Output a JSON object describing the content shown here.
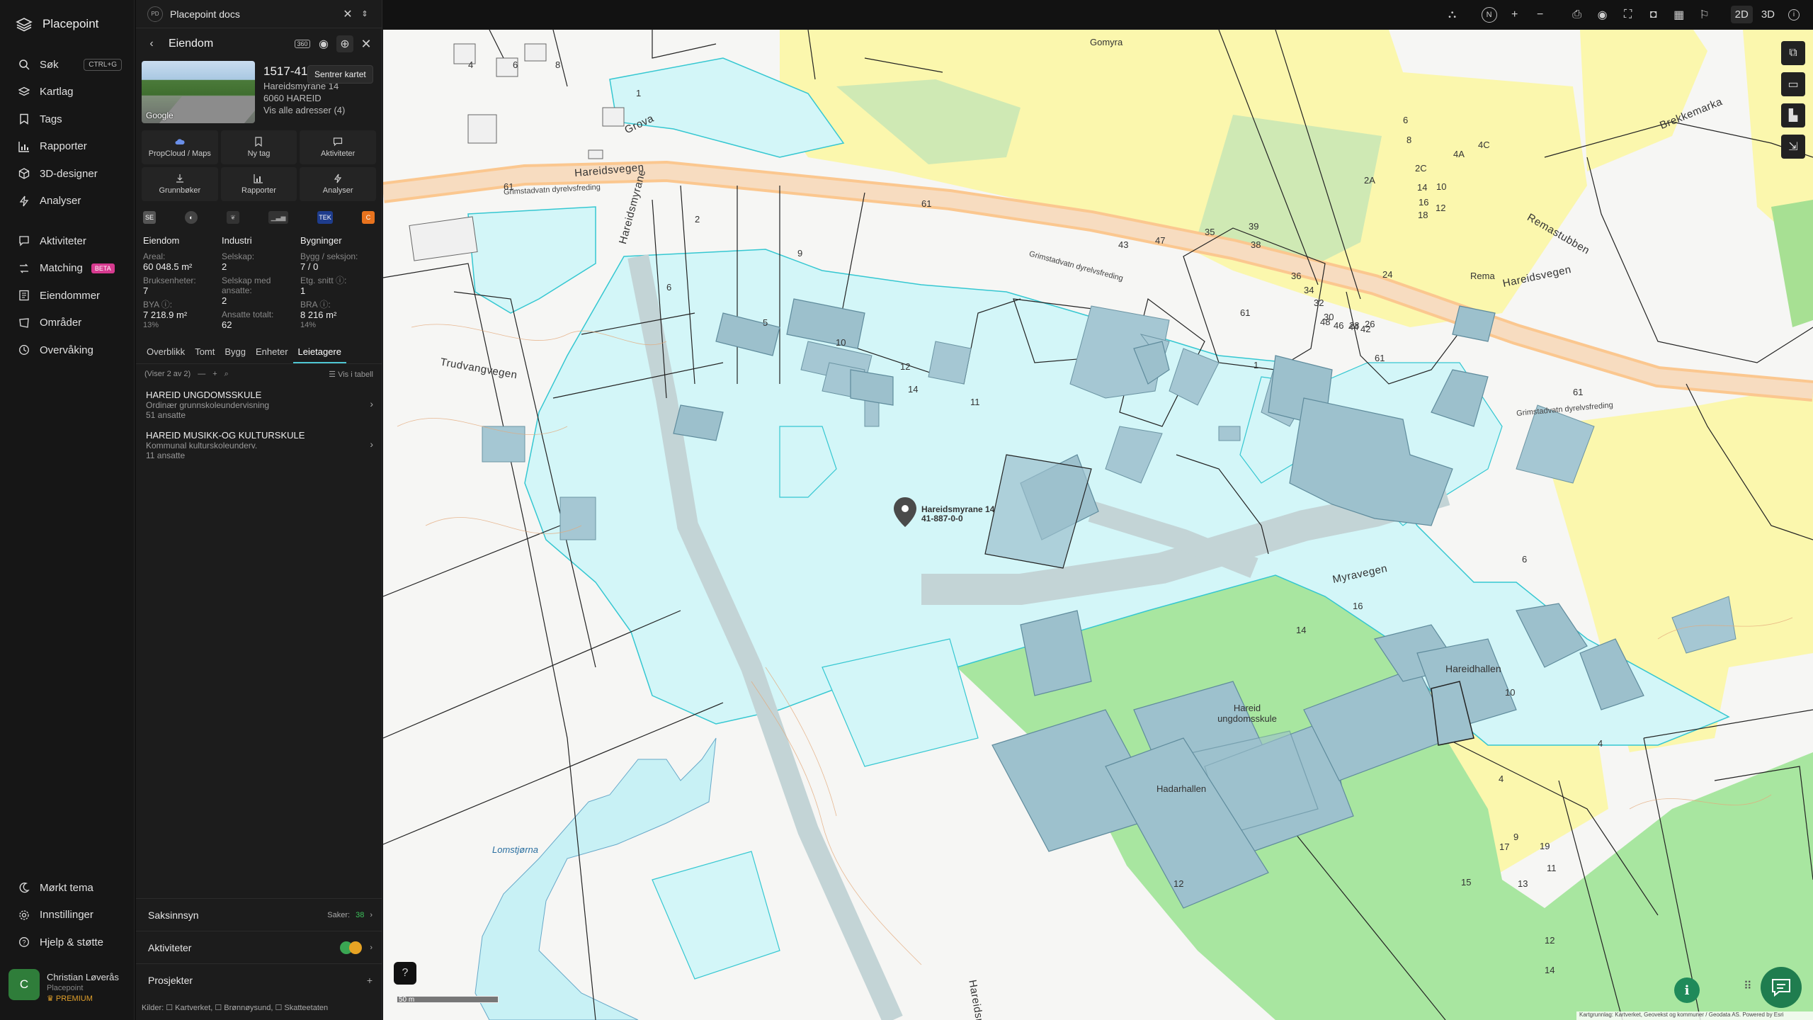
{
  "app": {
    "name": "Placepoint"
  },
  "nav": {
    "items": [
      {
        "label": "Søk",
        "shortcut": "CTRL+G"
      },
      {
        "label": "Kartlag"
      },
      {
        "label": "Tags"
      },
      {
        "label": "Rapporter"
      },
      {
        "label": "3D-designer"
      },
      {
        "label": "Analyser"
      },
      {
        "label": "Aktiviteter"
      },
      {
        "label": "Matching",
        "badge": "BETA"
      },
      {
        "label": "Eiendommer"
      },
      {
        "label": "Områder"
      },
      {
        "label": "Overvåking"
      }
    ],
    "bottom": [
      {
        "label": "Mørkt tema"
      },
      {
        "label": "Innstillinger"
      },
      {
        "label": "Hjelp & støtte"
      }
    ],
    "user": {
      "initial": "C",
      "name": "Christian Løverås",
      "org": "Placepoint",
      "plan": "PREMIUM"
    }
  },
  "panel": {
    "badge": "PD",
    "window_title": "Placepoint docs",
    "header_title": "Eiendom",
    "tooltip": "Sentrer kartet",
    "photo_credit": "Google",
    "property": {
      "id": "1517-41",
      "address": "Hareidsmyrane 14",
      "postal": "6060 HAREID",
      "all_addresses": "Vis alle adresser (4)"
    },
    "actions": [
      "PropCloud / Maps",
      "Ny tag",
      "Aktiviteter",
      "Grunnbøker",
      "Rapporter",
      "Analyser"
    ],
    "source_icons": [
      "SE",
      "◐",
      "❦",
      "▁▃▅",
      "TEK",
      "C"
    ],
    "stats": {
      "eiendom": {
        "heading": "Eiendom",
        "areal_label": "Areal:",
        "areal_value": "60 048.5 m²",
        "bruks_label": "Bruksenheter:",
        "bruks_value": "7",
        "bya_label": "BYA ⓘ:",
        "bya_value": "7 218.9 m²",
        "bya_pct": "13%"
      },
      "industri": {
        "heading": "Industri",
        "selskap_label": "Selskap:",
        "selskap_value": "2",
        "ansatte_label": "Selskap med ansatte:",
        "ansatte_value": "2",
        "total_label": "Ansatte totalt:",
        "total_value": "62"
      },
      "bygninger": {
        "heading": "Bygninger",
        "bygg_label": "Bygg / seksjon:",
        "bygg_value": "7 / 0",
        "etg_label": "Etg. snitt ⓘ:",
        "etg_value": "1",
        "bra_label": "BRA ⓘ:",
        "bra_value": "8 216 m²",
        "bra_pct": "14%"
      }
    },
    "tabs": [
      "Overblikk",
      "Tomt",
      "Bygg",
      "Enheter",
      "Leietagere"
    ],
    "active_tab": "Leietagere",
    "list_count": "(Viser 2 av 2)",
    "list_table": "Vis i tabell",
    "companies": [
      {
        "name": "HAREID UNGDOMSSKULE",
        "type": "Ordinær grunnskoleundervisning",
        "employees": "51 ansatte"
      },
      {
        "name": "HAREID MUSIKK-OG KULTURSKULE",
        "type": "Kommunal kulturskoleunderv.",
        "employees": "11 ansatte"
      }
    ],
    "sections": {
      "saksinnsyn": {
        "label": "Saksinnsyn",
        "saker_label": "Saker:",
        "saker_value": "38"
      },
      "aktiviteter": {
        "label": "Aktiviteter"
      },
      "prosjekter": {
        "label": "Prosjekter"
      }
    },
    "kilder": "Kilder:  ☐ Kartverket,  ☐ Brønnøysund,  ☐ Skatteetaten"
  },
  "topbar": {
    "compass": "N",
    "mode_2d": "2D",
    "mode_3d": "3D"
  },
  "map": {
    "roads": [
      "Hareidsvegen",
      "Hareidsvegen",
      "Hareidsmyrane",
      "Trudvangvegen",
      "Myravegen",
      "Grova",
      "Brekkemarka",
      "Remastubben",
      "Hareidsmyrane"
    ],
    "places": [
      "Gomyra",
      "Rema",
      "Lomstjørna"
    ],
    "buildings": [
      "Hareidhallen",
      "Hareid ungdomsskule",
      "Hadarhallen"
    ],
    "pin_label_1": "Hareidsmyrane 14",
    "pin_label_2": "41-887-0-0",
    "road_numbers": [
      "61",
      "61",
      "61",
      "61",
      "61"
    ],
    "fence_labels": [
      "Grimstadvatn dyrelvsfreding",
      "Grimstadvatn dyrelvsfreding",
      "Grimstadvatn dyrelvsfreding"
    ],
    "house_numbers": [
      "4",
      "6",
      "8",
      "1",
      "2",
      "6",
      "9",
      "5",
      "10",
      "12",
      "14",
      "11",
      "1",
      "16",
      "14",
      "12",
      "10",
      "4",
      "6",
      "4",
      "11",
      "9",
      "13",
      "15",
      "17",
      "19",
      "12",
      "14",
      "43",
      "47",
      "35",
      "39",
      "38",
      "36",
      "34",
      "32",
      "30",
      "28",
      "26",
      "24",
      "48",
      "46",
      "44",
      "42",
      "2A",
      "2C",
      "4A",
      "4C",
      "6",
      "8",
      "14",
      "16",
      "18",
      "10",
      "12"
    ],
    "scale": "50 m",
    "attribution": "Kartgrunnlag: Kartverket, Geovekst og kommuner / Geodata AS. Powered by Esri"
  }
}
